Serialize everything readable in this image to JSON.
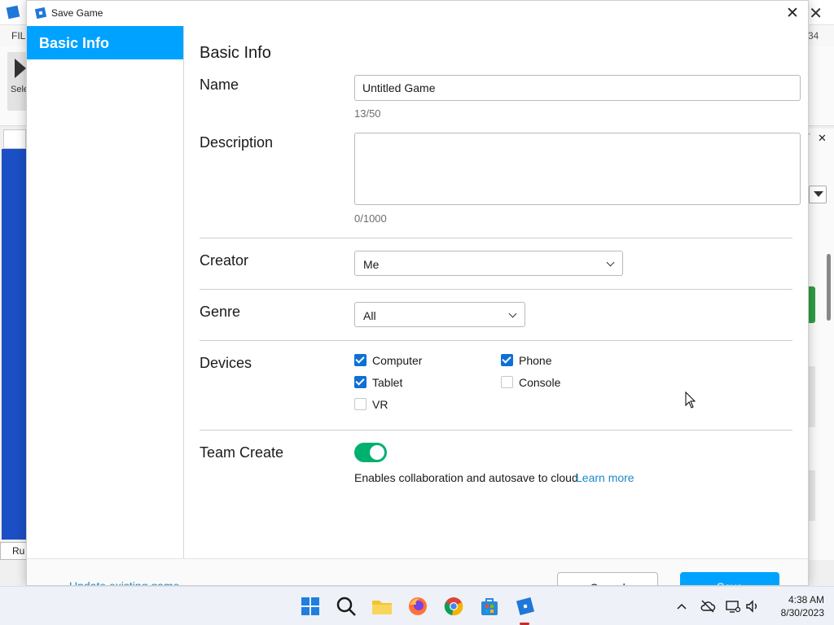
{
  "background_app": {
    "menu_file": "FILE",
    "menu_right_fragment": "34",
    "select_label": "Sele",
    "command_bar_fragment": "Ru"
  },
  "dialog": {
    "title": "Save Game",
    "sidebar": {
      "items": [
        {
          "label": "Basic Info",
          "selected": true
        }
      ]
    },
    "section_title": "Basic Info",
    "name": {
      "label": "Name",
      "value": "Untitled Game",
      "counter": "13/50"
    },
    "description": {
      "label": "Description",
      "value": "",
      "counter": "0/1000"
    },
    "creator": {
      "label": "Creator",
      "selected": "Me"
    },
    "genre": {
      "label": "Genre",
      "selected": "All"
    },
    "devices": {
      "label": "Devices",
      "options": [
        {
          "label": "Computer",
          "checked": true
        },
        {
          "label": "Phone",
          "checked": true
        },
        {
          "label": "Tablet",
          "checked": true
        },
        {
          "label": "Console",
          "checked": false
        },
        {
          "label": "VR",
          "checked": false
        }
      ]
    },
    "team_create": {
      "label": "Team Create",
      "enabled": true,
      "description": "Enables collaboration and autosave to cloud",
      "link": "Learn more"
    },
    "footer": {
      "update_link": "Update existing game",
      "cancel_label": "Cancel",
      "save_label": "Save"
    }
  },
  "colors": {
    "accent": "#00a2ff",
    "toggle_on": "#00b06f",
    "checkbox_on": "#0f6fd6",
    "link": "#1a88c9"
  },
  "taskbar": {
    "icons": [
      "windows-start-icon",
      "search-icon",
      "file-explorer-icon",
      "firefox-icon",
      "chrome-icon",
      "microsoft-store-icon",
      "roblox-studio-icon"
    ],
    "tray_icons": [
      "chevron-up-icon",
      "cloud-offline-icon",
      "monitor-icon",
      "speaker-icon"
    ],
    "time": "4:38 AM",
    "date": "8/30/2023"
  }
}
